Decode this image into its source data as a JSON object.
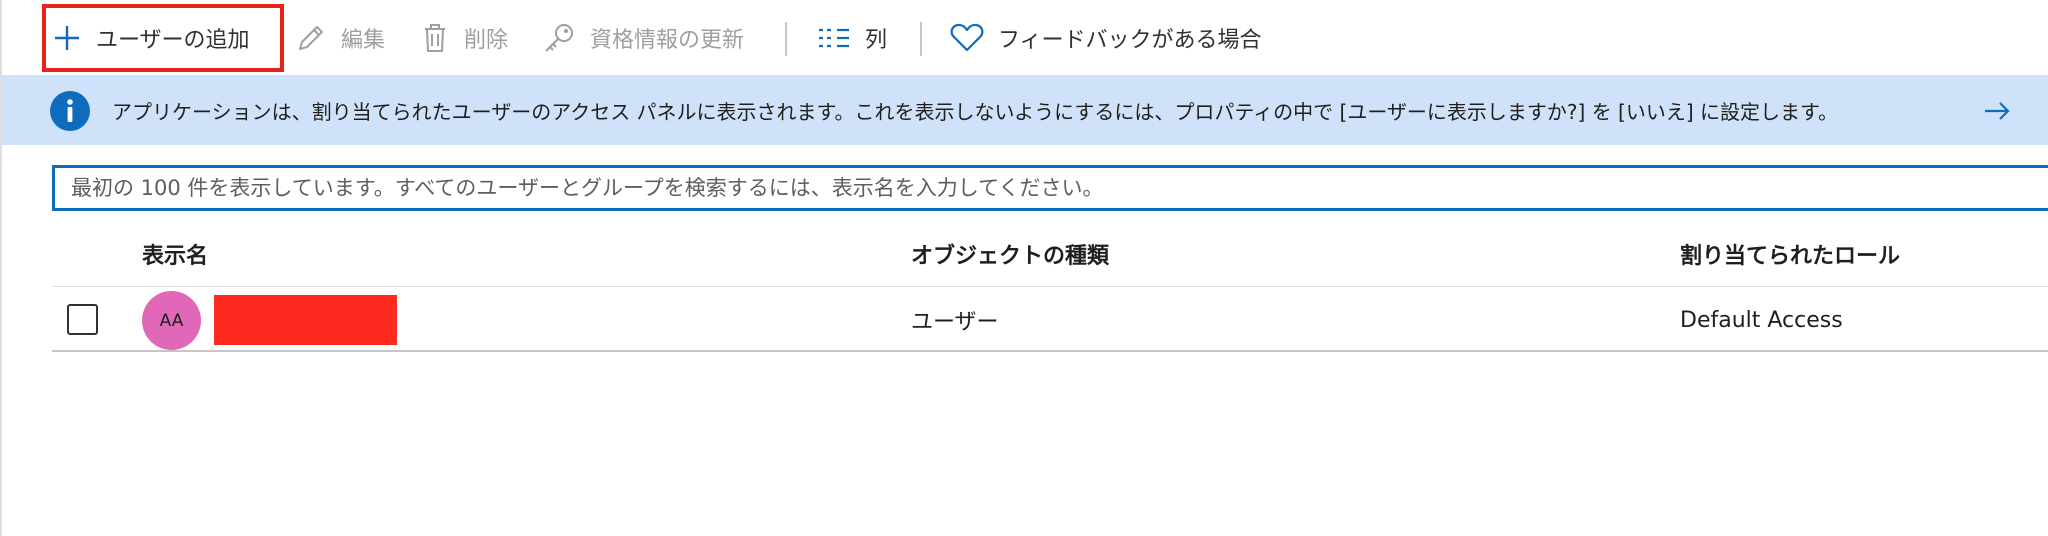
{
  "toolbar": {
    "add_user_label": "ユーザーの追加",
    "edit_label": "編集",
    "delete_label": "削除",
    "update_credentials_label": "資格情報の更新",
    "columns_label": "列",
    "feedback_label": "フィードバックがある場合"
  },
  "banner": {
    "message": "アプリケーションは、割り当てられたユーザーのアクセス パネルに表示されます。これを表示しないようにするには、プロパティの中で [ユーザーに表示しますか?] を [いいえ] に設定します。"
  },
  "search": {
    "placeholder": "最初の 100 件を表示しています。すべてのユーザーとグループを検索するには、表示名を入力してください。"
  },
  "table": {
    "headers": {
      "display_name": "表示名",
      "object_type": "オブジェクトの種類",
      "assigned_role": "割り当てられたロール"
    },
    "rows": [
      {
        "avatar_initials": "AA",
        "object_type": "ユーザー",
        "assigned_role": "Default Access"
      }
    ]
  },
  "colors": {
    "accent": "#0f6cbd",
    "banner_bg": "#cfe2fa",
    "highlight": "#e8231c",
    "avatar_bg": "#e167b8",
    "redaction": "#ff2a1f"
  },
  "icons": {
    "add": "plus-icon",
    "edit": "pencil-icon",
    "delete": "trash-icon",
    "credentials": "key-icon",
    "columns": "columns-icon",
    "feedback": "heart-icon",
    "info": "info-icon",
    "banner_link": "arrow-right-icon"
  }
}
